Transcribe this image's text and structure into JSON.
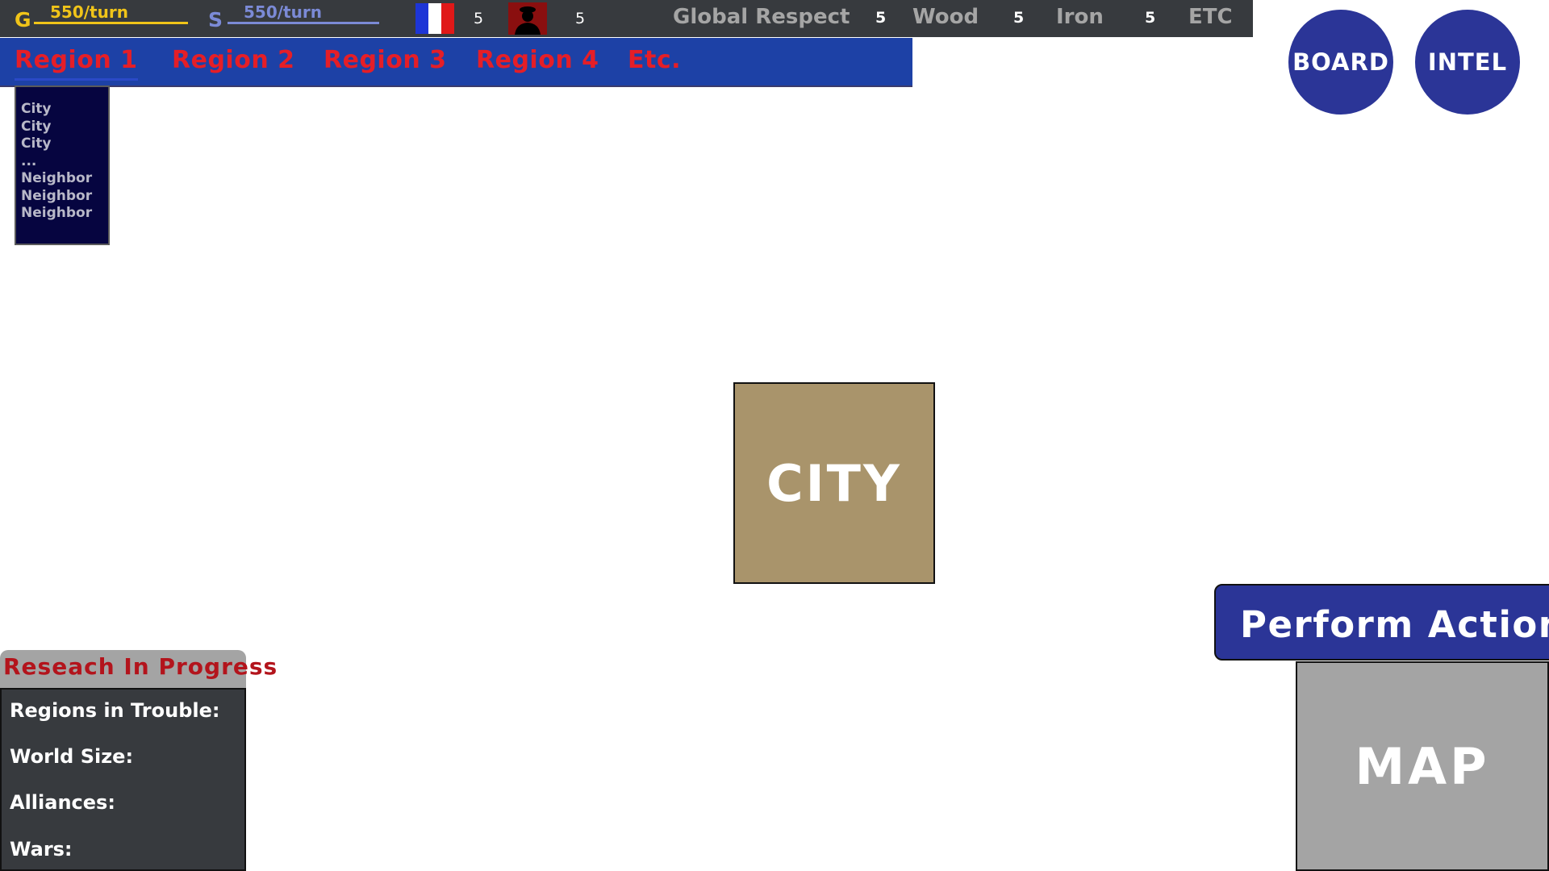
{
  "topbar": {
    "gold": {
      "letter": "G",
      "rate": "550/turn"
    },
    "silver": {
      "letter": "S",
      "rate": "550/turn"
    },
    "flag_count": "5",
    "leader_count": "5",
    "stats": [
      {
        "label": "Global Respect",
        "value": "5"
      },
      {
        "label": "Wood",
        "value": "5"
      },
      {
        "label": "Iron",
        "value": "5"
      },
      {
        "label": "ETC"
      }
    ]
  },
  "regions": [
    {
      "label": "Region 1",
      "active": true
    },
    {
      "label": "Region 2"
    },
    {
      "label": "Region 3"
    },
    {
      "label": "Region 4"
    },
    {
      "label": "Etc."
    }
  ],
  "dropdown": {
    "items": [
      "City",
      "City",
      "City",
      "...",
      "Neighbor",
      "Neighbor",
      "Neighbor"
    ]
  },
  "buttons": {
    "board": "BOARD",
    "intel": "INTEL",
    "perform_action": "Perform Action",
    "map": "MAP"
  },
  "city_tile": {
    "label": "CITY",
    "color": "#a9946b"
  },
  "research": {
    "header": "Reseach In Progress",
    "rows": [
      "Regions in Trouble:",
      "World Size:",
      "Alliances:",
      "Wars:"
    ]
  },
  "colors": {
    "topbar_bg": "#373a3e",
    "gold": "#f0c419",
    "silver": "#7b8ad6",
    "region_bar": "#1d41a6",
    "region_text": "#e51e27",
    "button_blue": "#2b3597",
    "map_gray": "#a4a4a4"
  },
  "icons": {
    "flag": "france-flag-icon",
    "leader": "leader-silhouette-icon"
  }
}
